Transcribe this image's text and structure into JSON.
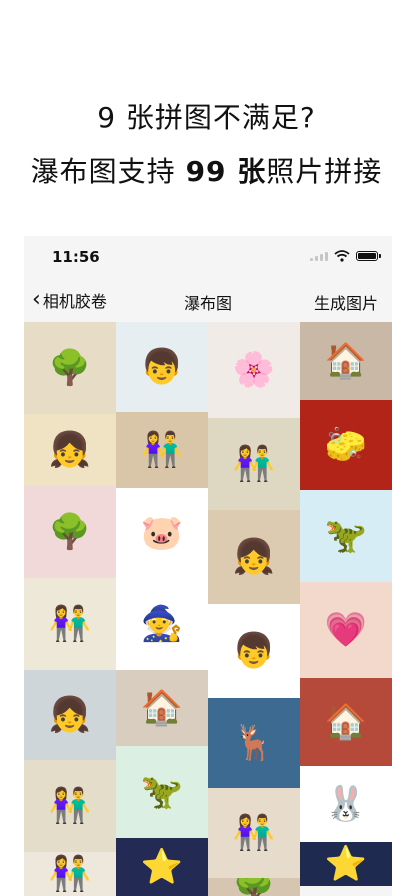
{
  "promo": {
    "line1": "9 张拼图不满足?",
    "line2_prefix": "瀑布图支持 ",
    "line2_bold": "99 张",
    "line2_suffix": "照片拼接"
  },
  "status_bar": {
    "time": "11:56"
  },
  "nav": {
    "back_label": "相机胶卷",
    "title": "瀑布图",
    "action_label": "生成图片"
  },
  "photo_columns": [
    [
      {
        "icon": "tree-icon",
        "h": 92,
        "bg": "#e7dcc6"
      },
      {
        "icon": "girl-icon",
        "h": 72,
        "bg": "#efe3c4"
      },
      {
        "icon": "tree-icon",
        "h": 92,
        "bg": "#f0d9d8"
      },
      {
        "icon": "couple-icon",
        "h": 92,
        "bg": "#eee8d8"
      },
      {
        "icon": "girl-icon",
        "h": 90,
        "bg": "#cfd6da"
      },
      {
        "icon": "couple-icon",
        "h": 92,
        "bg": "#e3ddc9"
      },
      {
        "icon": "couple-icon",
        "h": 44,
        "bg": "#eee7dc"
      }
    ],
    [
      {
        "icon": "boy-icon",
        "h": 90,
        "bg": "#e6eef2"
      },
      {
        "icon": "couple-icon",
        "h": 76,
        "bg": "#d9c6a9"
      },
      {
        "icon": "pig-icon",
        "h": 90,
        "bg": "#ffffff"
      },
      {
        "icon": "wizard-icon",
        "h": 92,
        "bg": "#ffffff"
      },
      {
        "icon": "shop-icon",
        "h": 76,
        "bg": "#d9cdbf"
      },
      {
        "icon": "dino-icon",
        "h": 92,
        "bg": "#dcefe3"
      },
      {
        "icon": "star-icon",
        "h": 58,
        "bg": "#232b55"
      }
    ],
    [
      {
        "icon": "flower-icon",
        "h": 96,
        "bg": "#f1ebe7"
      },
      {
        "icon": "couple-icon",
        "h": 92,
        "bg": "#ded8c3"
      },
      {
        "icon": "girl-icon",
        "h": 94,
        "bg": "#dccbb0"
      },
      {
        "icon": "boy-icon",
        "h": 94,
        "bg": "#ffffff"
      },
      {
        "icon": "deer-icon",
        "h": 90,
        "bg": "#3d6a90"
      },
      {
        "icon": "couple-icon",
        "h": 90,
        "bg": "#e7dccb"
      },
      {
        "icon": "tree-icon",
        "h": 18,
        "bg": "#d6c6b1"
      }
    ],
    [
      {
        "icon": "shop-icon",
        "h": 78,
        "bg": "#c9b8a6"
      },
      {
        "icon": "spongebob-icon",
        "h": 90,
        "bg": "#b22418"
      },
      {
        "icon": "dino-icon",
        "h": 92,
        "bg": "#d7edf5"
      },
      {
        "icon": "heart-icon",
        "h": 96,
        "bg": "#f3d9cc"
      },
      {
        "icon": "shop-icon",
        "h": 88,
        "bg": "#b54a3a"
      },
      {
        "icon": "rabbit-icon",
        "h": 76,
        "bg": "#ffffff"
      },
      {
        "icon": "star-icon",
        "h": 44,
        "bg": "#1e2a4f"
      }
    ]
  ]
}
